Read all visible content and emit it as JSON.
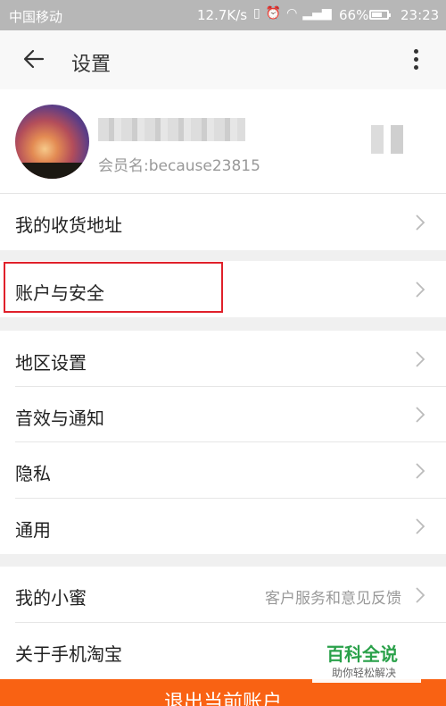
{
  "status_bar": {
    "carrier": "中国移动",
    "network_speed": "12.7K/s",
    "battery": "66%",
    "battery_level": 0.66,
    "time": "23:23"
  },
  "header": {
    "title": "设置"
  },
  "profile": {
    "member_name": "会员名:because23815"
  },
  "menu": [
    {
      "label": "我的收货地址"
    },
    {
      "label": "账户与安全"
    },
    {
      "label": "地区设置"
    },
    {
      "label": "音效与通知"
    },
    {
      "label": "隐私"
    },
    {
      "label": "通用"
    },
    {
      "label": "我的小蜜",
      "sub": "客户服务和意见反馈"
    },
    {
      "label": "关于手机淘宝"
    }
  ],
  "logout": {
    "label": "退出当前账户"
  },
  "watermark": {
    "title": "百科全说",
    "subtitle": "助你轻松解决"
  },
  "colors": {
    "accent": "#f96213",
    "highlight": "#e0202a",
    "watermark": "#2aa14a"
  }
}
